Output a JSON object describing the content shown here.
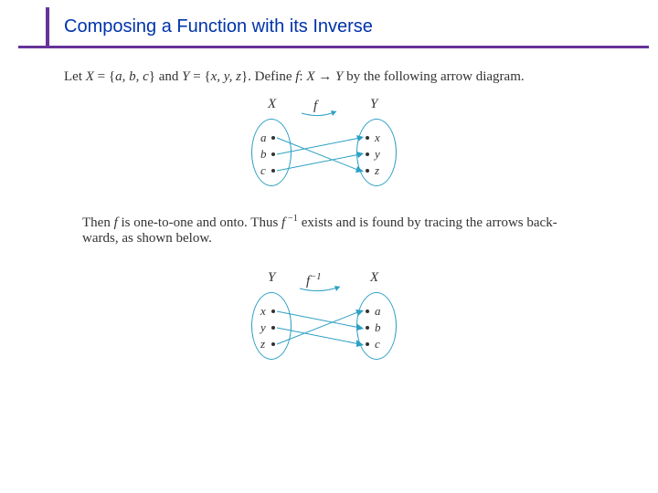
{
  "slide": {
    "title": "Composing a Function with its Inverse"
  },
  "text": {
    "line1_a": "Let ",
    "line1_b": "X",
    "line1_c": " = {",
    "line1_d": "a, b, c",
    "line1_e": "} and ",
    "line1_f": "Y",
    "line1_g": " = {",
    "line1_h": "x, y, z",
    "line1_i": "}. Define ",
    "line1_j": "f",
    "line1_k": ": ",
    "line1_l": "X",
    "line1_m": " → ",
    "line1_n": "Y",
    "line1_o": " by the following arrow diagram.",
    "line2_a": "Then ",
    "line2_b": "f",
    "line2_c": " is one-to-one and onto. Thus ",
    "line2_d": "f",
    "line2_e": " exists and is found by tracing the arrows back-",
    "line2_f": "wards, as shown below."
  },
  "diagram1": {
    "leftLabel": "X",
    "rightLabel": "Y",
    "funcLabel": "f",
    "left": {
      "e1": "a",
      "e2": "b",
      "e3": "c"
    },
    "right": {
      "e1": "x",
      "e2": "y",
      "e3": "z"
    },
    "mapping": [
      {
        "from": "a",
        "to": "z"
      },
      {
        "from": "b",
        "to": "x"
      },
      {
        "from": "c",
        "to": "y"
      }
    ]
  },
  "diagram2": {
    "leftLabel": "Y",
    "rightLabel": "X",
    "funcLabel": "f",
    "funcSup": "−1",
    "left": {
      "e1": "x",
      "e2": "y",
      "e3": "z"
    },
    "right": {
      "e1": "a",
      "e2": "b",
      "e3": "c"
    },
    "mapping": [
      {
        "from": "x",
        "to": "b"
      },
      {
        "from": "y",
        "to": "c"
      },
      {
        "from": "z",
        "to": "a"
      }
    ]
  }
}
